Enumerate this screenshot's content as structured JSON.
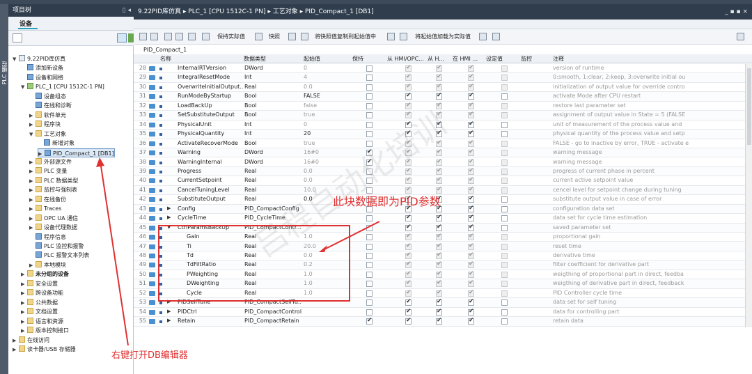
{
  "left_panel": {
    "title": "项目树",
    "vtab": "PLC 编程",
    "device_tab": "设备",
    "tree": [
      {
        "label": "9.22PID库仿真",
        "indent": 0,
        "arrow": "▼",
        "icon": "doc"
      },
      {
        "label": "添加新设备",
        "indent": 1,
        "arrow": "",
        "icon": "blue"
      },
      {
        "label": "设备和网络",
        "indent": 1,
        "arrow": "",
        "icon": "blue"
      },
      {
        "label": "PLC_1 [CPU 1512C-1 PN]",
        "indent": 1,
        "arrow": "▼",
        "icon": "green"
      },
      {
        "label": "设备组态",
        "indent": 2,
        "arrow": "",
        "icon": "blue"
      },
      {
        "label": "在线和诊断",
        "indent": 2,
        "arrow": "",
        "icon": "blue"
      },
      {
        "label": "软件单元",
        "indent": 2,
        "arrow": "▶",
        "icon": "fold"
      },
      {
        "label": "程序块",
        "indent": 2,
        "arrow": "▶",
        "icon": "fold"
      },
      {
        "label": "工艺对象",
        "indent": 2,
        "arrow": "▼",
        "icon": "fold"
      },
      {
        "label": "新增对象",
        "indent": 3,
        "arrow": "",
        "icon": "blue"
      },
      {
        "label": "PID_Compact_1 [DB1]",
        "indent": 3,
        "arrow": "▶",
        "icon": "blue"
      },
      {
        "label": "外部源文件",
        "indent": 2,
        "arrow": "▶",
        "icon": "fold"
      },
      {
        "label": "PLC 变量",
        "indent": 2,
        "arrow": "▶",
        "icon": "fold"
      },
      {
        "label": "PLC 数据类型",
        "indent": 2,
        "arrow": "▶",
        "icon": "fold"
      },
      {
        "label": "监控与强制表",
        "indent": 2,
        "arrow": "▶",
        "icon": "fold"
      },
      {
        "label": "在线备份",
        "indent": 2,
        "arrow": "▶",
        "icon": "fold"
      },
      {
        "label": "Traces",
        "indent": 2,
        "arrow": "▶",
        "icon": "fold"
      },
      {
        "label": "OPC UA 通信",
        "indent": 2,
        "arrow": "▶",
        "icon": "fold"
      },
      {
        "label": "设备代理数据",
        "indent": 2,
        "arrow": "▶",
        "icon": "fold"
      },
      {
        "label": "程序信息",
        "indent": 2,
        "arrow": "",
        "icon": "blue"
      },
      {
        "label": "PLC 监控和报警",
        "indent": 2,
        "arrow": "",
        "icon": "blue"
      },
      {
        "label": "PLC 报警文本列表",
        "indent": 2,
        "arrow": "",
        "icon": "blue"
      },
      {
        "label": "本地模块",
        "indent": 2,
        "arrow": "▶",
        "icon": "fold"
      },
      {
        "label": "未分组的设备",
        "indent": 1,
        "arrow": "▶",
        "icon": "fold",
        "bold": true
      },
      {
        "label": "安全设置",
        "indent": 1,
        "arrow": "▶",
        "icon": "fold"
      },
      {
        "label": "跨设备功能",
        "indent": 1,
        "arrow": "▶",
        "icon": "fold"
      },
      {
        "label": "公共数据",
        "indent": 1,
        "arrow": "▶",
        "icon": "fold"
      },
      {
        "label": "文档设置",
        "indent": 1,
        "arrow": "▶",
        "icon": "fold"
      },
      {
        "label": "语言和资源",
        "indent": 1,
        "arrow": "▶",
        "icon": "fold"
      },
      {
        "label": "版本控制接口",
        "indent": 1,
        "arrow": "▶",
        "icon": "fold"
      },
      {
        "label": "在线访问",
        "indent": 0,
        "arrow": "▶",
        "icon": "fold"
      },
      {
        "label": "读卡器/USB 存储器",
        "indent": 0,
        "arrow": "▶",
        "icon": "fold"
      }
    ]
  },
  "right_panel": {
    "breadcrumb": "9.22PID库仿真  ▸  PLC_1 [CPU 1512C-1 PN]  ▸  工艺对象  ▸  PID_Compact_1 [DB1]",
    "window_controls": "_ ▪ ▪ ×",
    "toolbar": {
      "snapshot_label": "保持实际值",
      "quick_label": "快照",
      "copy_label": "将快照值复制到起始值中",
      "load_label": "将起始值加载为实际值"
    },
    "db_name": "PID_Compact_1",
    "columns": {
      "name": "名称",
      "datatype": "数据类型",
      "start": "起始值",
      "retain": "保持",
      "hmi_opc": "从 HMI/OPC...",
      "from_h": "从 H...",
      "in_hmi": "在 HMI ...",
      "setpoint": "设定值",
      "monitor": "监控",
      "comment": "注释"
    },
    "rows": [
      {
        "n": "28",
        "name": "InternalRTVersion",
        "type": "DWord",
        "start": "0",
        "retain": false,
        "c1": true,
        "c2": true,
        "c3": true,
        "sp": false,
        "gray": true,
        "comment": "version of runtime"
      },
      {
        "n": "29",
        "name": "IntegralResetMode",
        "type": "Int",
        "start": "4",
        "retain": false,
        "c1": true,
        "c2": true,
        "c3": true,
        "sp": false,
        "gray": true,
        "comment": "0:smooth, 1:clear, 2:keep, 3:overwrite initial ou"
      },
      {
        "n": "30",
        "name": "OverwriteInitialOutput...",
        "type": "Real",
        "start": "0.0",
        "retain": false,
        "c1": true,
        "c2": true,
        "c3": true,
        "sp": false,
        "gray": true,
        "comment": "initialization of output value for override contro"
      },
      {
        "n": "31",
        "name": "RunModeByStartup",
        "type": "Bool",
        "start": "FALSE",
        "dark": true,
        "retain": false,
        "c1": true,
        "c2": true,
        "c3": true,
        "sp": false,
        "comment": "activate Mode after CPU restart"
      },
      {
        "n": "32",
        "name": "LoadBackUp",
        "type": "Bool",
        "start": "false",
        "retain": false,
        "c1": true,
        "c2": true,
        "c3": true,
        "sp": false,
        "gray": true,
        "comment": "restore last parameter set"
      },
      {
        "n": "33",
        "name": "SetSubstituteOutput",
        "type": "Bool",
        "start": "true",
        "retain": false,
        "c1": true,
        "c2": true,
        "c3": true,
        "sp": false,
        "gray": true,
        "comment": "assignment of output value in State = 5 (FALSE"
      },
      {
        "n": "34",
        "name": "PhysicalUnit",
        "type": "Int",
        "start": "0",
        "retain": false,
        "c1": true,
        "c2": true,
        "c3": true,
        "sp": false,
        "comment": "unit of measurement of the process value and"
      },
      {
        "n": "35",
        "name": "PhysicalQuantity",
        "type": "Int",
        "start": "20",
        "dark": true,
        "retain": false,
        "c1": true,
        "c2": true,
        "c3": true,
        "sp": false,
        "comment": "physical quantity of the process value and setp"
      },
      {
        "n": "36",
        "name": "ActivateRecoverMode",
        "type": "Bool",
        "start": "true",
        "retain": false,
        "c1": true,
        "c2": true,
        "c3": true,
        "sp": false,
        "gray": true,
        "comment": "FALSE - go to inactive by error, TRUE - activate e"
      },
      {
        "n": "37",
        "name": "Warning",
        "type": "DWord",
        "start": "16#0",
        "retain": true,
        "c1": true,
        "c2": true,
        "c3": true,
        "sp": false,
        "gray": true,
        "comment": "warning message"
      },
      {
        "n": "38",
        "name": "WarningInternal",
        "type": "DWord",
        "start": "16#0",
        "retain": true,
        "c1": true,
        "c2": true,
        "c3": true,
        "sp": false,
        "gray": true,
        "comment": "warning message"
      },
      {
        "n": "39",
        "name": "Progress",
        "type": "Real",
        "start": "0.0",
        "retain": false,
        "c1": true,
        "c2": true,
        "c3": true,
        "sp": false,
        "gray": true,
        "comment": "progress of current phase in percent"
      },
      {
        "n": "40",
        "name": "CurrentSetpoint",
        "type": "Real",
        "start": "0.0",
        "retain": false,
        "c1": true,
        "c2": true,
        "c3": true,
        "sp": false,
        "gray": true,
        "comment": "current active setpoint value"
      },
      {
        "n": "41",
        "name": "CancelTuningLevel",
        "type": "Real",
        "start": "10.0",
        "retain": false,
        "c1": true,
        "c2": true,
        "c3": true,
        "sp": false,
        "gray": true,
        "comment": "cencel level for setpoint change during tuning"
      },
      {
        "n": "42",
        "name": "SubstituteOutput",
        "type": "Real",
        "start": "0.0",
        "dark": true,
        "retain": false,
        "c1": true,
        "c2": true,
        "c3": true,
        "sp": false,
        "comment": "substitute output value in case of error"
      },
      {
        "n": "43",
        "name": "Config",
        "type": "PID_CompactConfig",
        "start": "",
        "tri": "▶",
        "retain": false,
        "c1": true,
        "c2": true,
        "c3": true,
        "sp": false,
        "comment": "configuration data set"
      },
      {
        "n": "44",
        "name": "CycleTime",
        "type": "PID_CycleTime",
        "start": "",
        "tri": "▶",
        "retain": false,
        "c1": true,
        "c2": true,
        "c3": true,
        "sp": false,
        "comment": "data set for cycle time estimation"
      },
      {
        "n": "45",
        "name": "CtrlParamsBackUp",
        "type": "PID_CompactContr...",
        "start": "",
        "tri": "▼",
        "retain": false,
        "c1": true,
        "c2": true,
        "c3": true,
        "sp": false,
        "comment": "saved parameter set"
      },
      {
        "n": "46",
        "name": "Gain",
        "type": "Real",
        "start": "1.0",
        "ind": true,
        "retain": false,
        "c1": true,
        "c2": true,
        "c3": true,
        "sp": false,
        "gray": true,
        "comment": "proportional gain"
      },
      {
        "n": "47",
        "name": "Ti",
        "type": "Real",
        "start": "20.0",
        "ind": true,
        "retain": false,
        "c1": true,
        "c2": true,
        "c3": true,
        "sp": false,
        "gray": true,
        "comment": "reset time"
      },
      {
        "n": "48",
        "name": "Td",
        "type": "Real",
        "start": "0.0",
        "ind": true,
        "retain": false,
        "c1": true,
        "c2": true,
        "c3": true,
        "sp": false,
        "gray": true,
        "comment": "derivative time"
      },
      {
        "n": "49",
        "name": "TdFiltRatio",
        "type": "Real",
        "start": "0.2",
        "ind": true,
        "retain": false,
        "c1": true,
        "c2": true,
        "c3": true,
        "sp": false,
        "gray": true,
        "comment": "filter coefficient for derivative part"
      },
      {
        "n": "50",
        "name": "PWeighting",
        "type": "Real",
        "start": "1.0",
        "ind": true,
        "retain": false,
        "c1": true,
        "c2": true,
        "c3": true,
        "sp": false,
        "gray": true,
        "comment": "weigthing of proportional part in direct, feedba"
      },
      {
        "n": "51",
        "name": "DWeighting",
        "type": "Real",
        "start": "1.0",
        "ind": true,
        "retain": false,
        "c1": true,
        "c2": true,
        "c3": true,
        "sp": false,
        "gray": true,
        "comment": "weigthing of derivative part in direct, feedback"
      },
      {
        "n": "52",
        "name": "Cycle",
        "type": "Real",
        "start": "1.0",
        "ind": true,
        "retain": false,
        "c1": true,
        "c2": true,
        "c3": true,
        "sp": false,
        "gray": true,
        "comment": "PID Controller cycle time"
      },
      {
        "n": "53",
        "name": "PIDSelfTune",
        "type": "PID_CompactSelfTu...",
        "start": "",
        "tri": "▶",
        "retain": false,
        "c1": true,
        "c2": true,
        "c3": true,
        "sp": false,
        "comment": "data set for self tuning"
      },
      {
        "n": "54",
        "name": "PIDCtrl",
        "type": "PID_CompactControl",
        "start": "",
        "tri": "▶",
        "retain": false,
        "c1": true,
        "c2": true,
        "c3": true,
        "sp": false,
        "comment": "data for controlling part"
      },
      {
        "n": "55",
        "name": "Retain",
        "type": "PID_CompactRetain",
        "start": "",
        "tri": "▶",
        "retain": true,
        "c1": true,
        "c2": true,
        "c3": true,
        "sp": false,
        "comment": "retain data"
      }
    ]
  },
  "annotations": {
    "box_label": "此块数据即为PID参数",
    "right_click_label": "右键打开DB编辑器"
  },
  "colors": {
    "title_bar": "#2f3d4d",
    "annotation": "#e03030",
    "selection": "#dbe8f6"
  }
}
